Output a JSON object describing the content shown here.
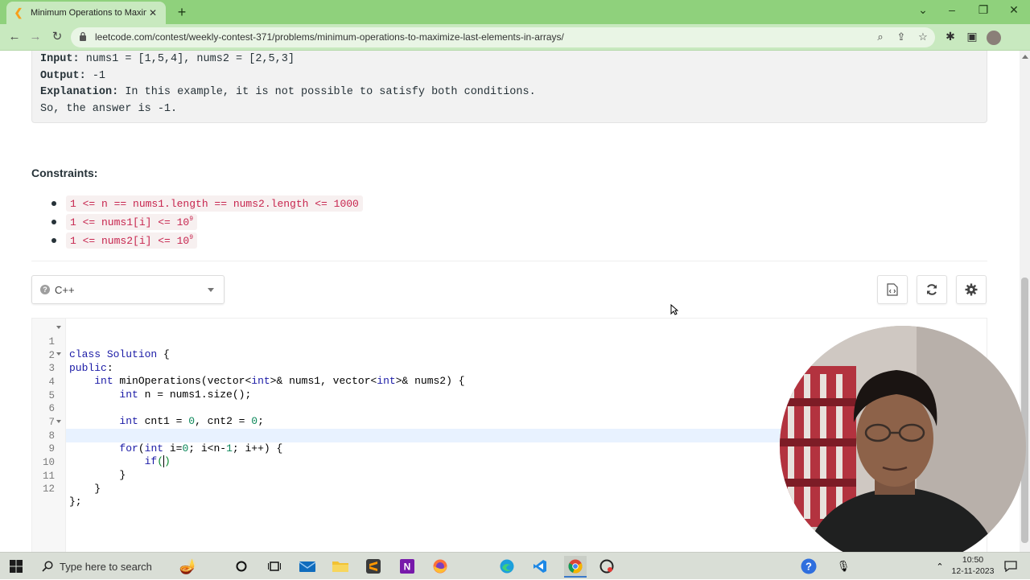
{
  "browser": {
    "tab_title": "Minimum Operations to Maximiz",
    "new_tab_symbol": "+",
    "url": "leetcode.com/contest/weekly-contest-371/problems/minimum-operations-to-maximize-last-elements-in-arrays/"
  },
  "example": {
    "input_label": "Input:",
    "input_value": " nums1 = [1,5,4], nums2 = [2,5,3]",
    "output_label": "Output:",
    "output_value": " -1",
    "explanation_label": "Explanation:",
    "explanation_value": " In this example, it is not possible to satisfy both conditions.",
    "explanation_cont": "So, the answer is -1."
  },
  "constraints": {
    "title": "Constraints:",
    "items": [
      {
        "text": "1 <= n == nums1.length == nums2.length <= 1000",
        "sup": ""
      },
      {
        "text": "1 <= nums1[i] <= 10",
        "sup": "9"
      },
      {
        "text": "1 <= nums2[i] <= 10",
        "sup": "9"
      }
    ]
  },
  "editor": {
    "language": "C++",
    "line_numbers": [
      "1",
      "2",
      "3",
      "4",
      "5",
      "6",
      "7",
      "8",
      "9",
      "10",
      "11",
      "12"
    ]
  },
  "taskbar": {
    "search_placeholder": "Type here to search",
    "time": "10:50",
    "date": "12-11-2023"
  },
  "colors": {
    "browser_tab_bar": "#8fd17c",
    "browser_toolbar": "#c8e9bf",
    "constraint_code_text": "#c7254e",
    "active_line": "#e8f2ff"
  },
  "icons": [
    "back-icon",
    "forward-icon",
    "reload-icon",
    "lock-icon",
    "zoom-icon",
    "share-icon",
    "star-icon",
    "extensions-icon",
    "sidepanel-icon",
    "avatar",
    "help-icon",
    "chevron-down-icon",
    "code-file-icon",
    "reset-icon",
    "gear-icon",
    "windows-start-icon",
    "search-icon"
  ]
}
